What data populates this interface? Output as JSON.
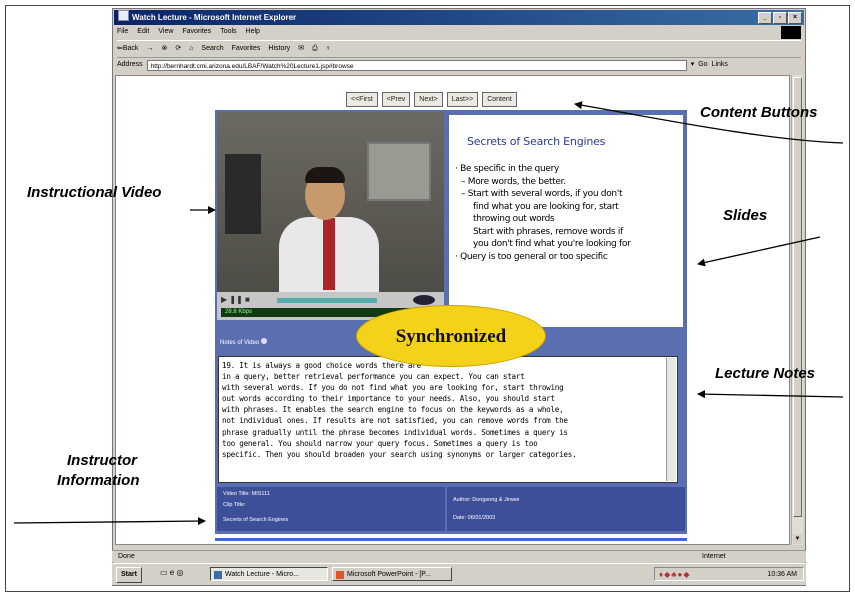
{
  "browser": {
    "title": "Watch Lecture - Microsoft Internet Explorer",
    "menu": [
      "File",
      "Edit",
      "View",
      "Favorites",
      "Tools",
      "Help"
    ],
    "toolbar": [
      "⇐Back",
      "→",
      "Search",
      "Favorites",
      "History"
    ],
    "address_label": "Address",
    "address_url": "http://bernhardt.cmi.arizona.edu/LBAF/Watch%20Lecture1.jsp#browse",
    "go_label": "Go",
    "links_label": "Links",
    "status_left": "Done",
    "status_right": "Internet"
  },
  "nav_buttons": [
    "<<First",
    "<Prev",
    "Next>",
    "Last>>",
    "Content"
  ],
  "video": {
    "status": "28.8 Kbps"
  },
  "slide": {
    "title": "Secrets of Search Engines",
    "lines": [
      {
        "text": "· Be specific in the query",
        "level": 1
      },
      {
        "text": "– More words, the better.",
        "level": 2
      },
      {
        "text": "– Start with several words, if you don't",
        "level": 2
      },
      {
        "text": "find what you are looking for, start",
        "level": 3
      },
      {
        "text": "throwing out words",
        "level": 3
      },
      {
        "text": "Start with phrases, remove words if",
        "level": 3
      },
      {
        "text": "you don't find what you're looking for",
        "level": 3
      },
      {
        "text": "· Query is too general or too specific",
        "level": 1
      }
    ]
  },
  "notes": {
    "label": "Notes of Video",
    "lines": [
      "19. It is always a good choice                                   words there are",
      "in a query, better retrieval performance you can expect. You can start",
      "with several words. If you do not find what you are looking for, start throwing",
      "out words according to their importance to your needs. Also, you should start",
      "with phrases. It enables the search engine to focus on the keywords as a whole,",
      "not individual ones. If results are not satisfied, you can remove words from the",
      "phrase gradually until the phrase becomes individual words. Sometimes a query is",
      "too general. You should narrow your query focus. Sometimes a query is too",
      "specific. Then you should broaden your search using synonyms or larger categories."
    ]
  },
  "info": {
    "video_title": "Video Title: MIS111",
    "clip_title": "Clip Title:",
    "clip_name": "Secrets of Search Engines",
    "author": "Author: Dongsong & Jinwei",
    "date": "Date: 06/01/2003"
  },
  "taskbar": {
    "start": "Start",
    "tasks": [
      "Watch Lecture - Micro...",
      "Microsoft PowerPoint - [P..."
    ],
    "time": "10:36 AM"
  },
  "annotations": {
    "content_buttons": "Content Buttons",
    "instructional_video": "Instructional Video",
    "slides": "Slides",
    "lecture_notes": "Lecture Notes",
    "instructor_info_1": "Instructor",
    "instructor_info_2": "Information",
    "synchronized": "Synchronized"
  }
}
